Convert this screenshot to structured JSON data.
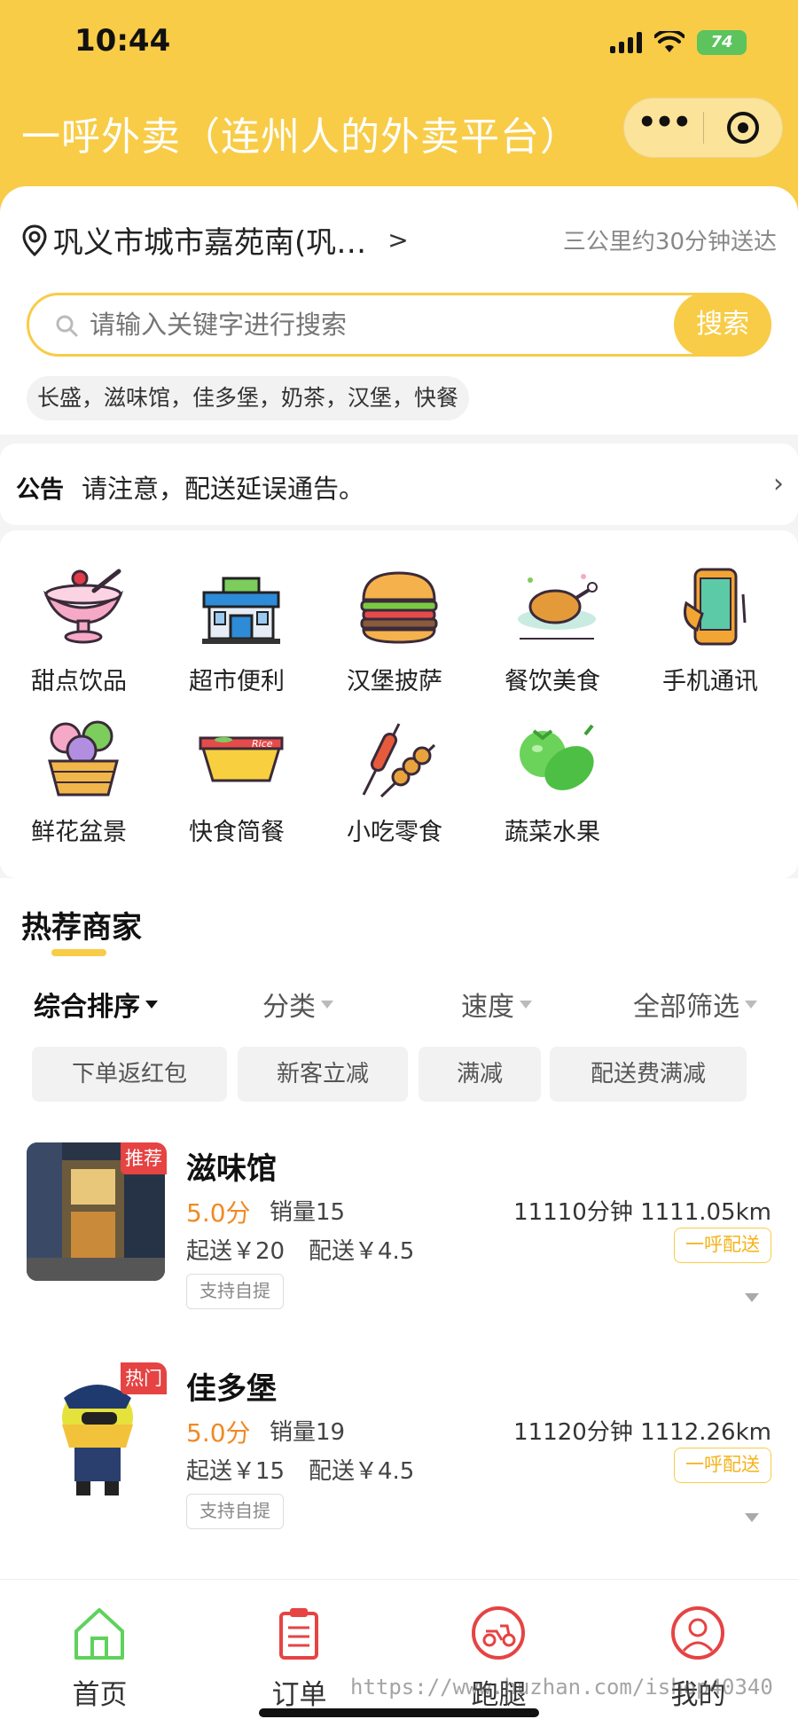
{
  "status_bar": {
    "time": "10:44",
    "battery": "74"
  },
  "header": {
    "title": "一呼外卖（连州人的外卖平台）"
  },
  "location": {
    "address": "巩义市城市嘉苑南(巩…",
    "arrow": ">",
    "delivery_note": "三公里约30分钟送达"
  },
  "search": {
    "placeholder": "请输入关键字进行搜索",
    "button": "搜索",
    "hot_words": "长盛，滋味馆，佳多堡，奶茶，汉堡，快餐"
  },
  "notice": {
    "label": "公告",
    "text": "请注意，配送延误通告。",
    "arrow": "›"
  },
  "categories": [
    {
      "label": "甜点饮品",
      "icon": "ice-cream-icon"
    },
    {
      "label": "超市便利",
      "icon": "supermarket-icon"
    },
    {
      "label": "汉堡披萨",
      "icon": "burger-icon"
    },
    {
      "label": "餐饮美食",
      "icon": "roast-chicken-icon"
    },
    {
      "label": "手机通讯",
      "icon": "phone-icon"
    },
    {
      "label": "鲜花盆景",
      "icon": "flower-basket-icon"
    },
    {
      "label": "快食简餐",
      "icon": "rice-bowl-icon"
    },
    {
      "label": "小吃零食",
      "icon": "skewer-icon"
    },
    {
      "label": "蔬菜水果",
      "icon": "vegetables-icon"
    }
  ],
  "recommend": {
    "title": "热荐商家",
    "sorts": [
      "综合排序",
      "分类",
      "速度",
      "全部筛选"
    ],
    "filters": [
      "下单返红包",
      "新客立减",
      "满减",
      "配送费满减"
    ],
    "shops": [
      {
        "tag": "推荐",
        "name": "滋味馆",
        "score": "5.0分",
        "sales": "销量15",
        "distance": "11110分钟 1111.05km",
        "min_order": "起送￥20",
        "delivery_fee": "配送￥4.5",
        "delivery_badge": "一呼配送",
        "self_pickup": "支持自提"
      },
      {
        "tag": "热门",
        "name": "佳多堡",
        "score": "5.0分",
        "sales": "销量19",
        "distance": "11120分钟 1112.26km",
        "min_order": "起送￥15",
        "delivery_fee": "配送￥4.5",
        "delivery_badge": "一呼配送",
        "self_pickup": "支持自提"
      }
    ]
  },
  "tabbar": [
    {
      "label": "首页",
      "icon": "home-icon",
      "active": true
    },
    {
      "label": "订单",
      "icon": "order-icon",
      "active": false
    },
    {
      "label": "跑腿",
      "icon": "delivery-icon",
      "active": false
    },
    {
      "label": "我的",
      "icon": "profile-icon",
      "active": false
    }
  ],
  "watermark": "https://www.huzhan.com/ishop40340",
  "colors": {
    "brand": "#f8cc47",
    "score": "#f08a24",
    "tag": "#e64343",
    "active_tab": "#5ed25c",
    "tab_icon": "#e64343"
  }
}
